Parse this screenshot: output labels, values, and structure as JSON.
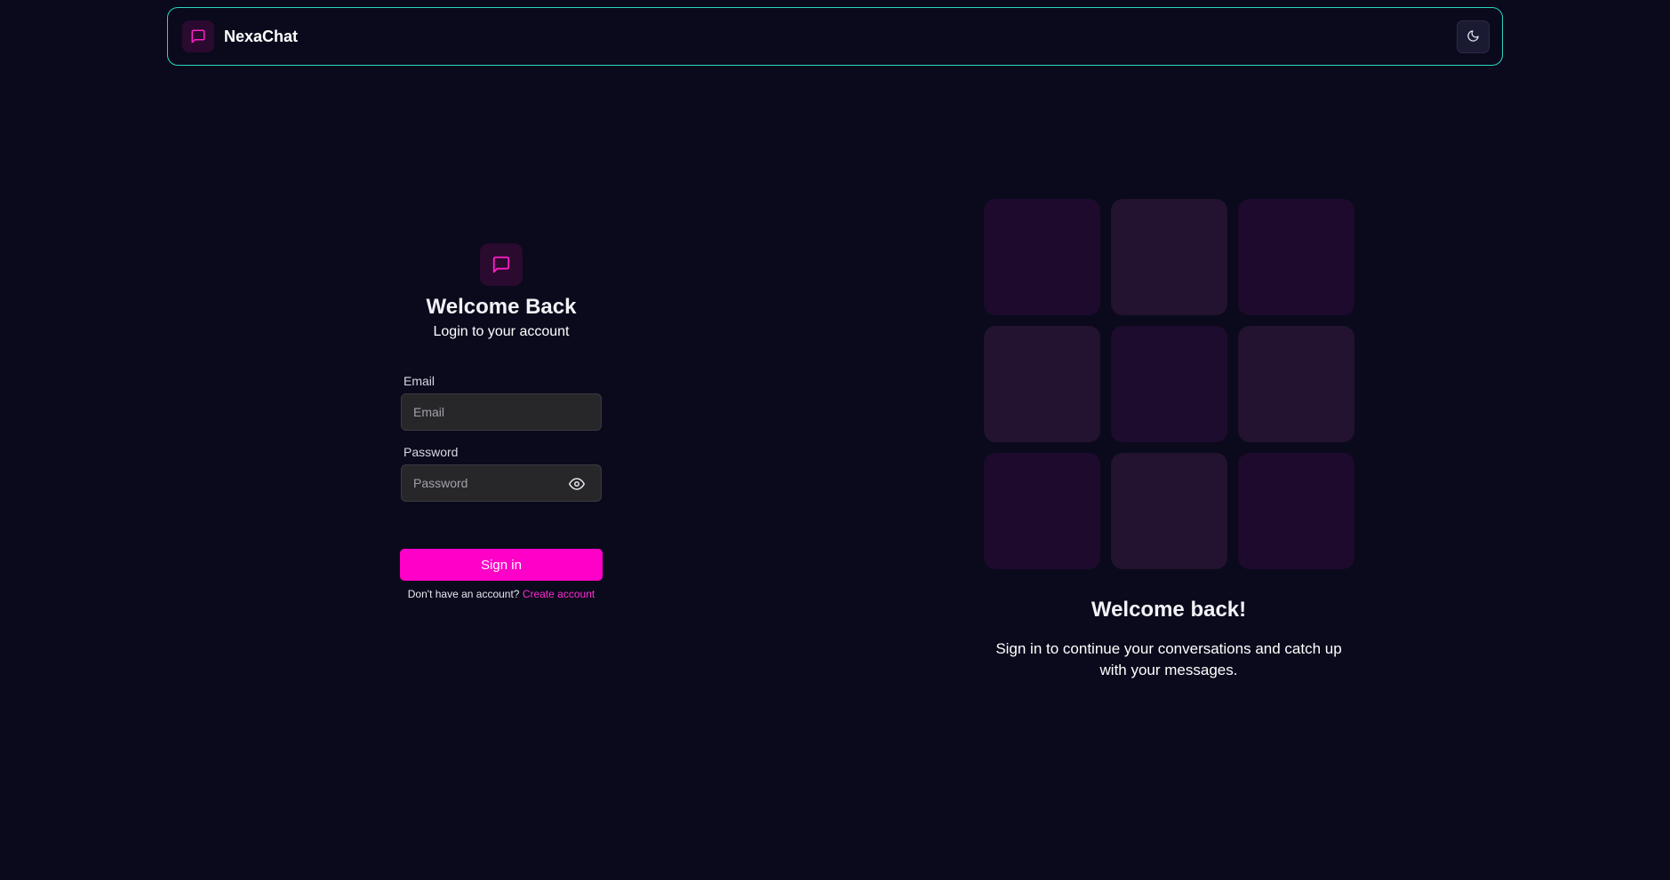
{
  "navbar": {
    "brand_name": "NexaChat",
    "brand_icon": "message-square-icon",
    "theme_icon": "moon-icon"
  },
  "login": {
    "icon": "message-square-icon",
    "title": "Welcome Back",
    "subtitle": "Login to your account",
    "email_label": "Email",
    "email_placeholder": "Email",
    "email_value": "",
    "password_label": "Password",
    "password_placeholder": "Password",
    "password_value": "",
    "password_toggle_icon": "eye-icon",
    "signin_label": "Sign in",
    "no_account_text": "Don't have an account?",
    "create_account_label": "Create account"
  },
  "promo": {
    "title": "Welcome back!",
    "text": "Sign in to continue your conversations and catch up with your messages."
  },
  "colors": {
    "background": "#0a0a1c",
    "accent": "#ff00c8",
    "nav_border": "#2dd4bf",
    "icon_tile": "#2a0a2e",
    "input_bg": "#27272a"
  }
}
